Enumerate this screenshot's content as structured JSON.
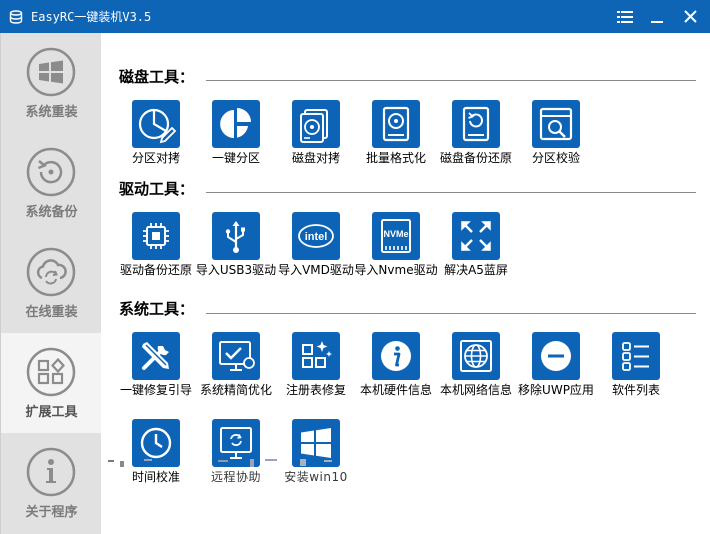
{
  "window": {
    "title": "EasyRC一键装机V3.5",
    "accent": "#0e64b5"
  },
  "sidebar": {
    "items": [
      {
        "label": "系统重装",
        "icon": "windows-logo-icon",
        "active": false
      },
      {
        "label": "系统备份",
        "icon": "backup-restore-icon",
        "active": false
      },
      {
        "label": "在线重装",
        "icon": "cloud-sync-icon",
        "active": false
      },
      {
        "label": "扩展工具",
        "icon": "grid-shapes-icon",
        "active": true
      },
      {
        "label": "关于程序",
        "icon": "info-icon",
        "active": false
      }
    ]
  },
  "sections": [
    {
      "title": "磁盘工具：",
      "tools": [
        {
          "label": "分区对拷",
          "icon": "partition-copy-icon"
        },
        {
          "label": "一键分区",
          "icon": "pie-partition-icon"
        },
        {
          "label": "磁盘对拷",
          "icon": "disk-copy-icon"
        },
        {
          "label": "批量格式化",
          "icon": "hard-drive-icon"
        },
        {
          "label": "磁盘备份还原",
          "icon": "disk-backup-icon"
        },
        {
          "label": "分区校验",
          "icon": "partition-check-icon"
        }
      ]
    },
    {
      "title": "驱动工具：",
      "tools": [
        {
          "label": "驱动备份还原",
          "icon": "chip-icon"
        },
        {
          "label": "导入USB3驱动",
          "icon": "usb-icon"
        },
        {
          "label": "导入VMD驱动",
          "icon": "intel-icon",
          "badge": "intel"
        },
        {
          "label": "导入Nvme驱动",
          "icon": "nvme-icon",
          "badge": "NVMe"
        },
        {
          "label": "解决A5蓝屏",
          "icon": "expand-arrows-icon"
        }
      ]
    },
    {
      "title": "系统工具：",
      "tools": [
        {
          "label": "一键修复引导",
          "icon": "repair-tools-icon"
        },
        {
          "label": "系统精简优化",
          "icon": "monitor-optimize-icon"
        },
        {
          "label": "注册表修复",
          "icon": "registry-icon"
        },
        {
          "label": "本机硬件信息",
          "icon": "info-circle-icon"
        },
        {
          "label": "本机网络信息",
          "icon": "globe-icon"
        },
        {
          "label": "移除UWP应用",
          "icon": "minus-circle-icon"
        },
        {
          "label": "软件列表",
          "icon": "software-list-icon"
        },
        {
          "label": "时间校准",
          "icon": "clock-icon"
        },
        {
          "label": "远程协助",
          "icon": "remote-monitor-icon"
        },
        {
          "label": "安装win10",
          "icon": "windows-install-icon"
        }
      ]
    }
  ]
}
